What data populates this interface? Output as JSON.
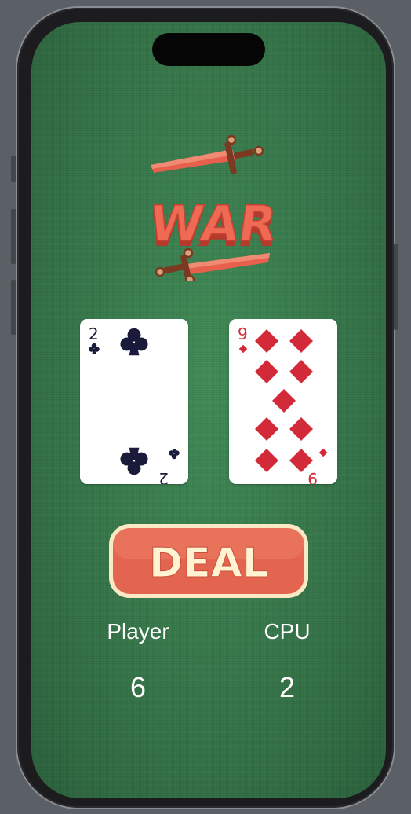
{
  "game": {
    "title_logo": "WAR",
    "deal_label": "DEAL",
    "player": {
      "label": "Player",
      "score": "6"
    },
    "cpu": {
      "label": "CPU",
      "score": "2"
    }
  },
  "cards": {
    "player": {
      "rank": "2",
      "suit": "clubs",
      "color": "#1a1a3a"
    },
    "cpu": {
      "rank": "9",
      "suit": "diamonds",
      "color": "#d32a3a"
    }
  },
  "colors": {
    "felt": "#37784b",
    "logo_red": "#e05a4a",
    "button_red": "#e4654f",
    "button_text": "#fff3d1",
    "hilt_brown": "#7a3a22"
  }
}
